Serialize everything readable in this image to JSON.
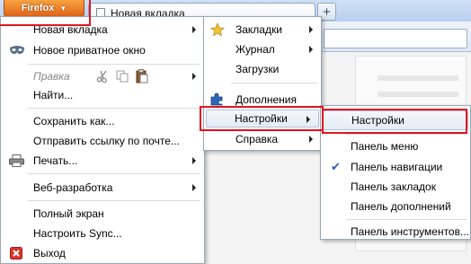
{
  "firefox_button": {
    "label": "Firefox",
    "arrow": "▼"
  },
  "tab": {
    "title": "Новая вкладка"
  },
  "newtab": {
    "symbol": "+"
  },
  "main_menu": {
    "new_tab": "Новая вкладка",
    "private_window": "Новое приватное окно",
    "edit": "Правка",
    "find": "Найти...",
    "save_as": "Сохранить как...",
    "send_link": "Отправить ссылку по почте...",
    "print": "Печать...",
    "web_dev": "Веб-разработка",
    "full_screen": "Полный экран",
    "setup_sync": "Настроить Sync...",
    "exit": "Выход"
  },
  "side_menu": {
    "bookmarks": "Закладки",
    "history": "Журнал",
    "downloads": "Загрузки",
    "addons": "Дополнения",
    "settings": "Настройки",
    "help": "Справка"
  },
  "settings_submenu": {
    "settings": "Настройки",
    "menu_bar": "Панель меню",
    "navigation_bar": "Панель навигации",
    "bookmarks_bar": "Панель закладок",
    "addons_bar": "Панель дополнений",
    "toolbars": "Панель инструментов...",
    "check_mark": "✔"
  },
  "colors": {
    "firefox_orange": "#e8761f",
    "highlight_border": "#e0161f",
    "check_blue": "#1f5fbf"
  }
}
